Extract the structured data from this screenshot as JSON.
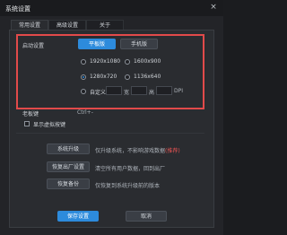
{
  "window": {
    "title": "系统设置",
    "close_glyph": "×"
  },
  "tabs": [
    {
      "label": "常用设置"
    },
    {
      "label": "高级设置"
    },
    {
      "label": "关于"
    }
  ],
  "startup": {
    "label": "启动设置",
    "tablet_label": "平板版",
    "phone_label": "手机版"
  },
  "resolutions": [
    {
      "label": "1920x1080"
    },
    {
      "label": "1600x900"
    },
    {
      "label": "1280x720",
      "checked": true
    },
    {
      "label": "1136x640"
    }
  ],
  "custom": {
    "label": "自定义",
    "width_label": "宽",
    "height_label": "高",
    "dpi_label": "DPI"
  },
  "boss_key": {
    "label": "老板键",
    "value": "Ctrl+-"
  },
  "show_fps": {
    "label": "显示虚拟按键"
  },
  "actions": [
    {
      "button": "系统升级",
      "desc": "仅升级系统，不影响游戏数据",
      "desc_red": "(推荐)"
    },
    {
      "button": "恢复出厂设置",
      "desc": "清空所有用户数据，回到出厂",
      "desc_red": ""
    },
    {
      "button": "恢复备份",
      "desc": "仅恢复到系统升级前的版本",
      "desc_red": ""
    }
  ],
  "footer": {
    "save_label": "保存设置",
    "cancel_label": "取消"
  },
  "colors": {
    "accent": "#2d8bdc",
    "highlight_box": "#e24a4a"
  }
}
